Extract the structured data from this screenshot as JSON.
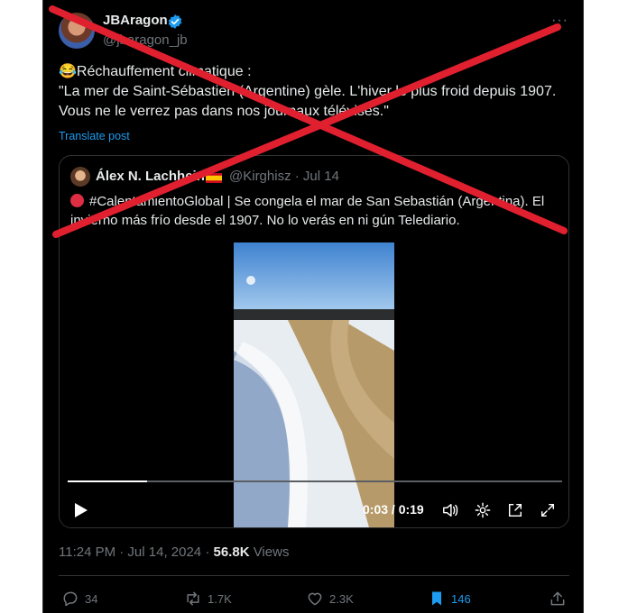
{
  "tweet": {
    "author_name": "JBAragon",
    "author_handle": "@jbaragon_jb",
    "more_label": "···",
    "text_line1": "😂Réchauffement climatique :",
    "text_line2": "\"La mer de Saint-Sébastien (Argentine) gèle. L'hiver le plus froid depuis 1907. Vous ne le verrez pas dans nos journaux télévisés.\"",
    "translate_label": "Translate post",
    "timestamp": "11:24 PM · Jul 14, 2024",
    "views_count": "56.8K",
    "views_label": " Views"
  },
  "quoted": {
    "author_name": "Álex N. Lachhein",
    "author_handle": "@Kirghisz · Jul 14",
    "text": "#CalentamientoGlobal |  Se congela el mar de San Sebastián (Argentina). El invierno más frío desde el 1907.  No lo verás en ni gún Telediario.",
    "video": {
      "time_label": "0:03 / 0:19",
      "progress": 0.16
    }
  },
  "actions": {
    "replies": "34",
    "reposts": "1.7K",
    "likes": "2.3K",
    "bookmarks": "146"
  },
  "icons": [
    "verified-badge-icon",
    "more-icon",
    "red-circle-icon",
    "spain-flag-icon",
    "play-icon",
    "volume-icon",
    "settings-icon",
    "pip-icon",
    "fullscreen-icon",
    "reply-icon",
    "repost-icon",
    "like-icon",
    "bookmark-icon",
    "share-icon"
  ],
  "colors": {
    "background": "#000000",
    "text": "#e7e9ea",
    "muted": "#71767b",
    "accent": "#1d9bf0",
    "cross": "#e0202f"
  }
}
